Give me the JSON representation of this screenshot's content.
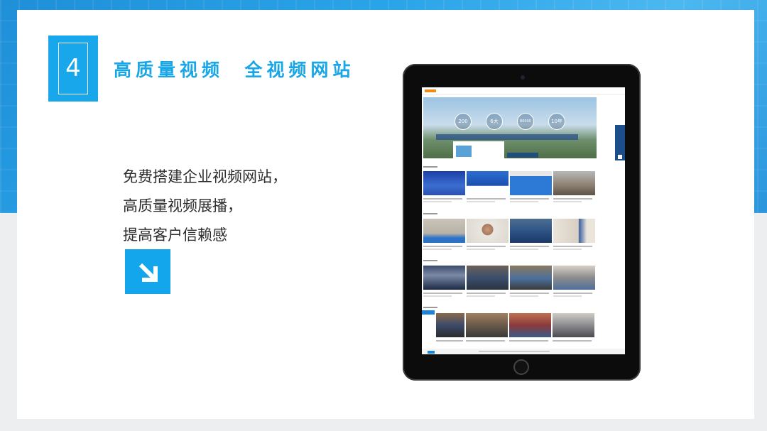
{
  "slide": {
    "number": "4",
    "title": "高质量视频  全视频网站",
    "description_lines": [
      "免费搭建企业视频网站，",
      "高质量视频展播，",
      "提高客户信赖感"
    ],
    "arrow_icon": "arrow-down-right-icon"
  },
  "colors": {
    "accent": "#17a7ea",
    "background_band": "#2aa4e8",
    "text": "#2c2c2c"
  },
  "tablet_screen": {
    "banner_stats": [
      "200",
      "6大",
      "80000",
      "10年"
    ]
  }
}
